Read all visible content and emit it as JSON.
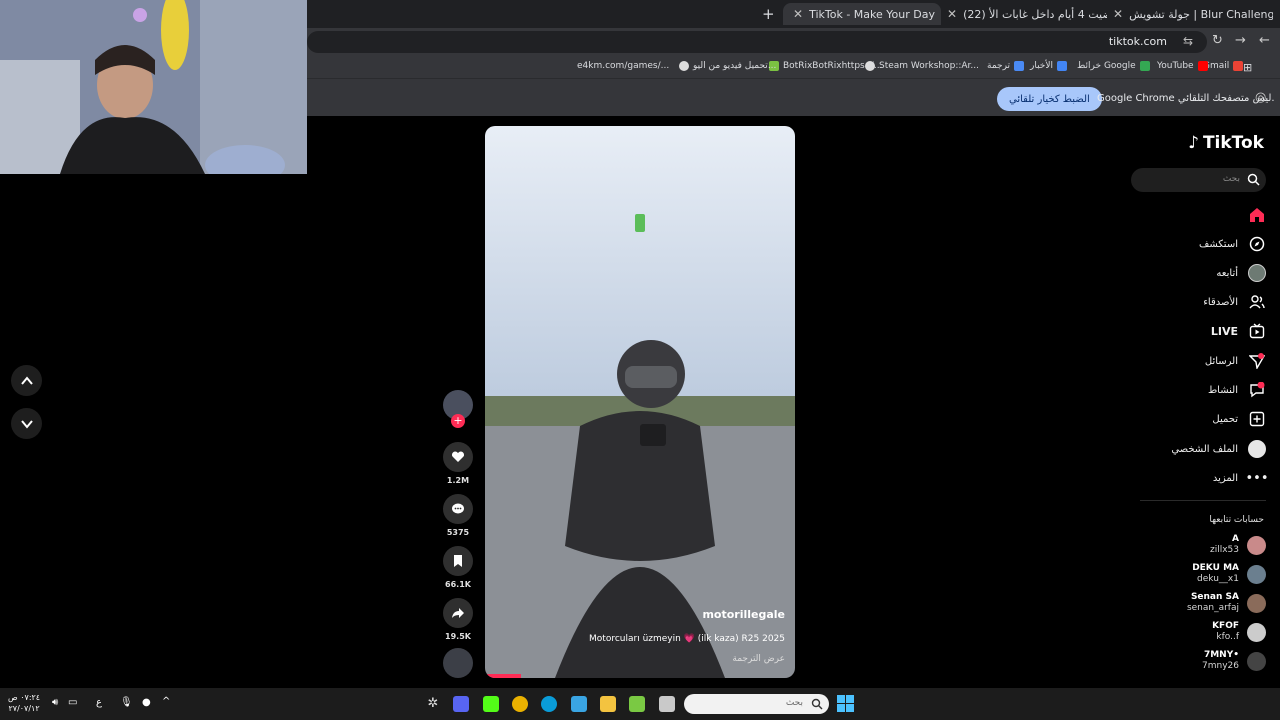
{
  "browser": {
    "tabs": [
      {
        "title": "جولة تشويش | Blur Challenge",
        "active": false
      },
      {
        "title": "(22) قضيت 4 أيام داخل غابات الأ...",
        "active": false
      },
      {
        "title": "TikTok - Make Your Day",
        "active": true
      }
    ],
    "new_tab": "+",
    "url": "tiktok.com",
    "bookmarks": [
      "Gmail",
      "YouTube",
      "خرائط Google",
      "الأخبار",
      "ترجمة",
      "Steam Workshop::Ar...",
      "BotRixBotRixhttps://...",
      "تحميل فيديو من اليو...",
      "e4km.com/games/..."
    ],
    "infobar": {
      "message": "Google Chrome ليس متصفحك التلقائي.",
      "button": "الضبط كخيار تلقائي"
    }
  },
  "tiktok": {
    "logo": "TikTok",
    "search_placeholder": "بحث",
    "nav": [
      {
        "label": "",
        "icon": "home-icon"
      },
      {
        "label": "استكشف",
        "icon": "compass-icon"
      },
      {
        "label": "أتابعه",
        "icon": "following-avatar-icon"
      },
      {
        "label": "الأصدقاء",
        "icon": "friends-icon"
      },
      {
        "label": "LIVE",
        "icon": "live-icon"
      },
      {
        "label": "الرسائل",
        "icon": "messages-icon"
      },
      {
        "label": "النشاط",
        "icon": "activity-icon"
      },
      {
        "label": "تحميل",
        "icon": "upload-icon"
      },
      {
        "label": "الملف الشخصي",
        "icon": "profile-icon"
      },
      {
        "label": "المزيد",
        "icon": "more-icon"
      }
    ],
    "following_title": "حسابات تتابعها",
    "following": [
      {
        "name": "A",
        "username": "zillx53",
        "color": "#c98a8a"
      },
      {
        "name": "DEKU MA",
        "username": "deku__x1",
        "color": "#6b7f8f"
      },
      {
        "name": "Senan SA",
        "username": "senan_arfaj",
        "color": "#8a6b5a"
      },
      {
        "name": "KFOF",
        "username": "kfo..f",
        "color": "#cccccc"
      },
      {
        "name": "7MNY•",
        "username": "7mny26",
        "color": "#444444"
      }
    ],
    "video": {
      "author": "motorillegale",
      "caption": "Motorcuları üzmeyin 💗 (ilk kaza) R25 2025",
      "translate": "عرض الترجمة"
    },
    "actions": {
      "likes": "1.2M",
      "comments": "5375",
      "saves": "66.1K",
      "shares": "19.5K"
    }
  },
  "taskbar": {
    "time": "٠٧:٢٤ ص",
    "date": "٢٧/٠٧/١٢",
    "lang": "ع",
    "search_placeholder": "بحث"
  },
  "colors": {
    "tiktok_red": "#fe2c55",
    "chrome_blue": "#a8c7fa"
  }
}
